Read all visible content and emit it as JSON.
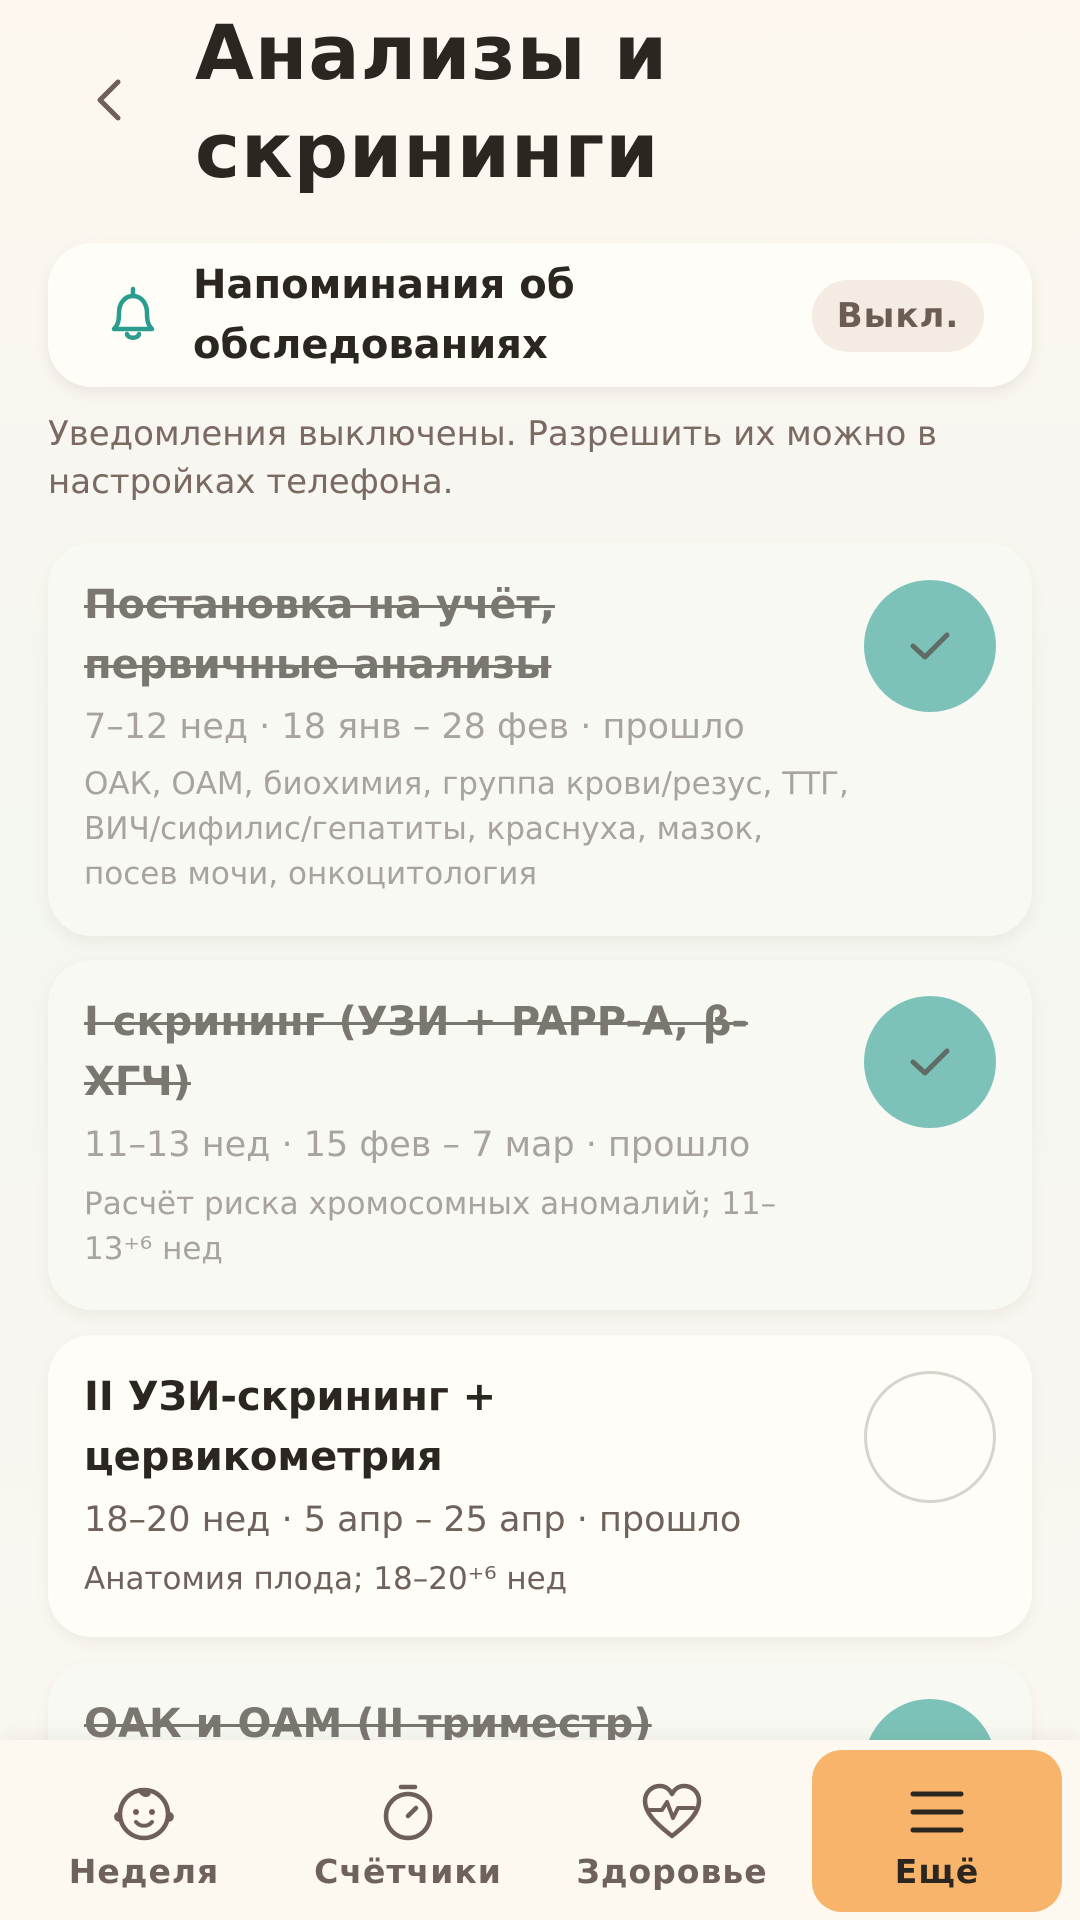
{
  "header": {
    "title_line1": "Анализы и",
    "title_line2": "скрининги"
  },
  "reminder": {
    "label_line1": "Напоминания об",
    "label_line2": "обследованиях",
    "toggle_label": "Выкл."
  },
  "notice_text": "Уведомления выключены. Разрешить их можно в настройках телефона.",
  "items": [
    {
      "title": "Постановка на учёт, первичные анализы",
      "meta": "7–12 нед · 18 янв – 28 фев · прошло",
      "desc": "ОАК, ОАМ, биохимия, группа крови/резус, ТТГ, ВИЧ/сифилис/гепатиты, краснуха, мазок, посев мочи, онкоцитология",
      "done": true
    },
    {
      "title": "I скрининг (УЗИ + PAPP-A, β-ХГЧ)",
      "meta": "11–13 нед · 15 фев – 7 мар · прошло",
      "desc": "Расчёт риска хромосомных аномалий; 11–13⁺⁶ нед",
      "done": true
    },
    {
      "title": "II УЗИ-скрининг + цервикометрия",
      "meta": "18–20 нед · 5 апр – 25 апр · прошло",
      "desc": "Анатомия плода; 18–20⁺⁶ нед",
      "done": false
    },
    {
      "title": "ОАК и ОАМ (II триместр)",
      "done": true
    }
  ],
  "nav": {
    "week": "Неделя",
    "counters": "Счётчики",
    "health": "Здоровье",
    "more": "Ещё"
  },
  "colors": {
    "accent_teal": "#7cc2b8",
    "accent_orange": "#f7b46a",
    "bell_teal": "#2a9d8f"
  }
}
